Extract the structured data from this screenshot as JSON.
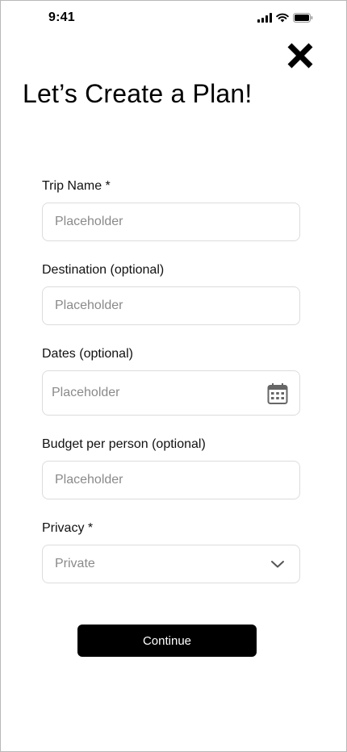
{
  "status_bar": {
    "time": "9:41",
    "icons": [
      "signal-icon",
      "wifi-icon",
      "battery-icon"
    ]
  },
  "header": {
    "close_icon": "close-icon",
    "title": "Let’s Create a Plan!"
  },
  "form": {
    "trip_name": {
      "label": "Trip Name *",
      "placeholder": "Placeholder",
      "value": ""
    },
    "destination": {
      "label": "Destination (optional)",
      "placeholder": "Placeholder",
      "value": ""
    },
    "dates": {
      "label": "Dates (optional)",
      "placeholder": "Placeholder",
      "value": "",
      "icon": "calendar-icon"
    },
    "budget": {
      "label": "Budget per person (optional)",
      "placeholder": "Placeholder",
      "value": ""
    },
    "privacy": {
      "label": "Privacy *",
      "selected": "Private",
      "icon": "chevron-down-icon"
    },
    "continue_label": "Continue"
  },
  "colors": {
    "primary_button": "#000000",
    "primary_button_text": "#ffffff",
    "field_border": "#dcdcdc",
    "placeholder_text": "#8a8a8a"
  }
}
